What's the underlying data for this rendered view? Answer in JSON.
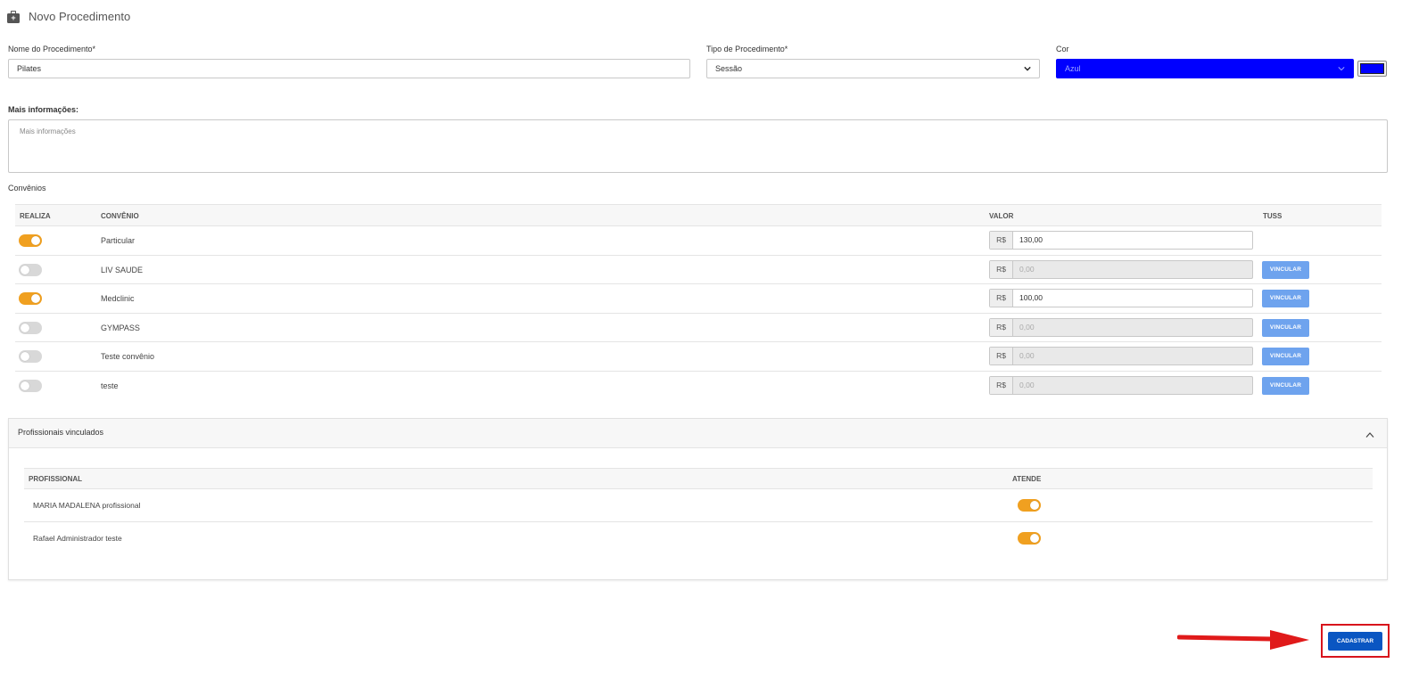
{
  "header": {
    "icon": "medical-bag-icon",
    "title": "Novo Procedimento"
  },
  "form": {
    "nome_label": "Nome do Procedimento*",
    "nome_value": "Pilates",
    "tipo_label": "Tipo de Procedimento*",
    "tipo_value": "Sessão",
    "cor_label": "Cor",
    "cor_value": "Azul",
    "cor_hex": "#0000ff",
    "info_label": "Mais informações:",
    "info_placeholder": "Mais informações"
  },
  "convenios": {
    "section_label": "Convênios",
    "columns": {
      "realiza": "REALIZA",
      "convenio": "CONVÊNIO",
      "valor": "VALOR",
      "tuss": "TUSS"
    },
    "currency": "R$",
    "vincular_label": "VINCULAR",
    "rows": [
      {
        "realiza": true,
        "name": "Particular",
        "valor": "130,00",
        "vincular": false
      },
      {
        "realiza": false,
        "name": "LIV SAUDE",
        "valor": "0,00",
        "vincular": true
      },
      {
        "realiza": true,
        "name": "Medclinic",
        "valor": "100,00",
        "vincular": true
      },
      {
        "realiza": false,
        "name": "GYMPASS",
        "valor": "0,00",
        "vincular": true
      },
      {
        "realiza": false,
        "name": "Teste convênio",
        "valor": "0,00",
        "vincular": true
      },
      {
        "realiza": false,
        "name": "teste",
        "valor": "0,00",
        "vincular": true
      }
    ]
  },
  "profissionais": {
    "title": "Profissionais vinculados",
    "columns": {
      "profissional": "PROFISSIONAL",
      "atende": "ATENDE"
    },
    "rows": [
      {
        "name": "MARIA MADALENA profissional",
        "atende": true
      },
      {
        "name": "Rafael Administrador teste",
        "atende": true
      }
    ]
  },
  "actions": {
    "submit_label": "CADASTRAR"
  },
  "colors": {
    "toggle_on": "#f0a020",
    "toggle_off": "#d8d8d8",
    "vincular": "#6ea3ee",
    "submit": "#0a56c2",
    "highlight": "#d8141c"
  }
}
